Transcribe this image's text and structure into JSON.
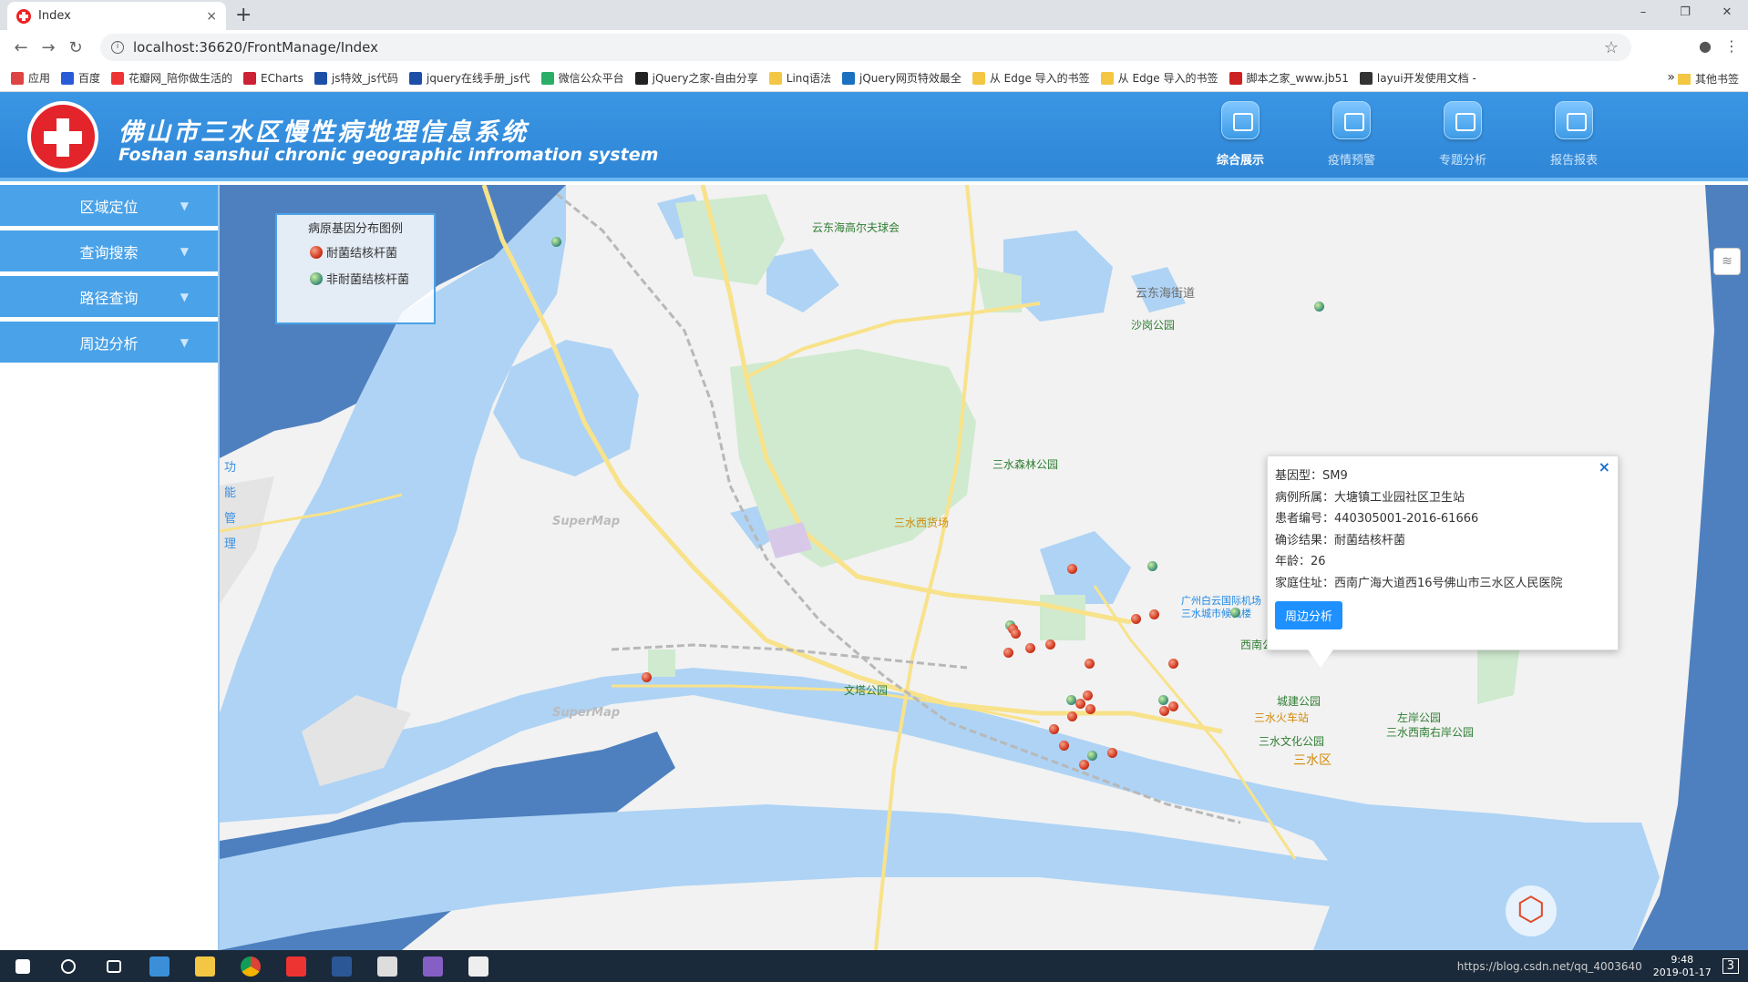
{
  "browser": {
    "tab_title": "Index",
    "tab_close": "×",
    "new_tab": "+",
    "url": "localhost:36620/FrontManage/Index",
    "win_min": "–",
    "win_max": "❐",
    "win_close": "✕"
  },
  "bookmarks": [
    {
      "label": "应用",
      "color": "#d44"
    },
    {
      "label": "百度",
      "color": "#2a5bd7"
    },
    {
      "label": "花瓣网_陪你做生活的",
      "color": "#e33"
    },
    {
      "label": "ECharts",
      "color": "#c23"
    },
    {
      "label": "js特效_js代码",
      "color": "#1d4fa8"
    },
    {
      "label": "jquery在线手册_js代",
      "color": "#1d4fa8"
    },
    {
      "label": "微信公众平台",
      "color": "#2aae67"
    },
    {
      "label": "jQuery之家-自由分享",
      "color": "#222"
    },
    {
      "label": "Linq语法",
      "color": "#f3c744"
    },
    {
      "label": "jQuery网页特效最全",
      "color": "#1d6fbf"
    },
    {
      "label": "从 Edge 导入的书签",
      "color": "#f3c744"
    },
    {
      "label": "从 Edge 导入的书签",
      "color": "#f3c744"
    },
    {
      "label": "脚本之家_www.jb51",
      "color": "#c22"
    },
    {
      "label": "layui开发使用文档 -",
      "color": "#333"
    }
  ],
  "bookmarks_more": "»",
  "bookmarks_other": "其他书签",
  "header": {
    "title": "佛山市三水区慢性病地理信息系统",
    "subtitle": "Foshan sanshui chronic geographic infromation system",
    "nav": [
      {
        "label": "综合展示",
        "active": true
      },
      {
        "label": "疫情预警",
        "active": false
      },
      {
        "label": "专题分析",
        "active": false
      },
      {
        "label": "报告报表",
        "active": false
      }
    ]
  },
  "sidebar": {
    "items": [
      {
        "label": "区域定位",
        "caret": "▼"
      },
      {
        "label": "查询搜索",
        "caret": "▼"
      },
      {
        "label": "路径查询",
        "caret": "▼"
      },
      {
        "label": "周边分析",
        "caret": "▼"
      }
    ],
    "func_tab": [
      "功",
      "能",
      "管",
      "理"
    ]
  },
  "legend": {
    "title": "病原基因分布图例",
    "items": [
      {
        "label": "耐菌结核杆菌",
        "type": "red"
      },
      {
        "label": "非耐菌结核杆菌",
        "type": "green"
      }
    ]
  },
  "map_labels": [
    {
      "text": "云东海高尔夫球会",
      "color": "#2e7d32"
    },
    {
      "text": "云东海街道",
      "color": "#6d6d6d"
    },
    {
      "text": "沙岗公园",
      "color": "#2e7d32"
    },
    {
      "text": "三水森林公园",
      "color": "#2e7d32"
    },
    {
      "text": "三水西货场",
      "color": "#d08a0a"
    },
    {
      "text": "广州白云国际机场",
      "color": "#1e88e5"
    },
    {
      "text": "三水城市候机楼",
      "color": "#1e88e5"
    },
    {
      "text": "西南公园",
      "color": "#2e7d32"
    },
    {
      "text": "文塔公园",
      "color": "#2e7d32"
    },
    {
      "text": "城建公园",
      "color": "#2e7d32"
    },
    {
      "text": "三水火车站",
      "color": "#d08a0a"
    },
    {
      "text": "三水文化公园",
      "color": "#2e7d32"
    },
    {
      "text": "三水区",
      "color": "#d08a0a"
    },
    {
      "text": "左岸公园",
      "color": "#2e7d32"
    },
    {
      "text": "三水西南右岸公园",
      "color": "#2e7d32"
    },
    {
      "text": "SuperMap",
      "color": "#bbbbbb"
    },
    {
      "text": "SuperMap",
      "color": "#bbbbbb"
    }
  ],
  "popup": {
    "rows": [
      "基因型：SM9",
      "病例所属：大塘镇工业园社区卫生站",
      "患者编号：440305001-2016-61666",
      "确诊结果：耐菌结核杆菌",
      "年龄：26",
      "家庭住址：西南广海大道西16号佛山市三水区人民医院"
    ],
    "button": "周边分析",
    "close": "×"
  },
  "taskbar": {
    "time": "9:48",
    "date": "2019-01-17",
    "watermark": "https://blog.csdn.net/qq_4003640",
    "notif": "3"
  },
  "colors": {
    "header_bg": "#2f86d6",
    "sidebar_item": "#4aa2e8",
    "water": "#aed3f5",
    "deep_water": "#4e80bf",
    "park": "#cfeacf",
    "road": "#f8e28a"
  }
}
